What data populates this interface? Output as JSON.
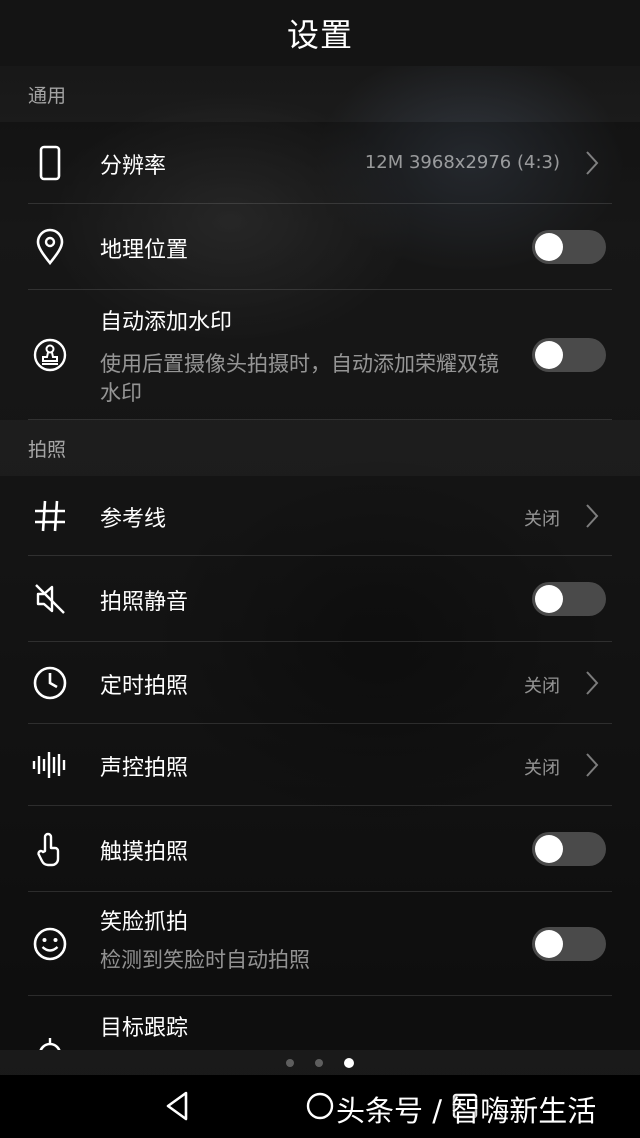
{
  "header": {
    "title": "设置"
  },
  "sections": {
    "general": {
      "title": "通用"
    },
    "photo": {
      "title": "拍照"
    }
  },
  "rows": {
    "resolution": {
      "label": "分辨率",
      "value": "12M 3968x2976 (4:3)",
      "icon": "phone-outline-icon"
    },
    "location": {
      "label": "地理位置",
      "toggle_on": false,
      "icon": "location-pin-icon"
    },
    "watermark": {
      "label": "自动添加水印",
      "sub": "使用后置摄像头拍摄时，自动添加荣耀双镜水印",
      "toggle_on": false,
      "icon": "stamp-icon"
    },
    "grid": {
      "label": "参考线",
      "value": "关闭",
      "icon": "grid-icon"
    },
    "mute": {
      "label": "拍照静音",
      "toggle_on": false,
      "icon": "speaker-mute-icon"
    },
    "timer": {
      "label": "定时拍照",
      "value": "关闭",
      "icon": "clock-icon"
    },
    "voice": {
      "label": "声控拍照",
      "value": "关闭",
      "icon": "sound-wave-icon"
    },
    "touch": {
      "label": "触摸拍照",
      "toggle_on": false,
      "icon": "touch-hand-icon"
    },
    "smile": {
      "label": "笑脸抓拍",
      "sub": "检测到笑脸时自动拍照",
      "toggle_on": false,
      "icon": "smile-icon"
    },
    "tracking": {
      "label": "目标跟踪",
      "toggle_on": false,
      "icon": "target-tracking-icon"
    }
  },
  "pager": {
    "count": 3,
    "active_index": 2
  },
  "watermark_overlay": {
    "text": "头条号 / 智嗨新生活"
  },
  "colors": {
    "background": "#141414",
    "toggle_off": "#4a4a4a",
    "text": "#ffffff"
  }
}
